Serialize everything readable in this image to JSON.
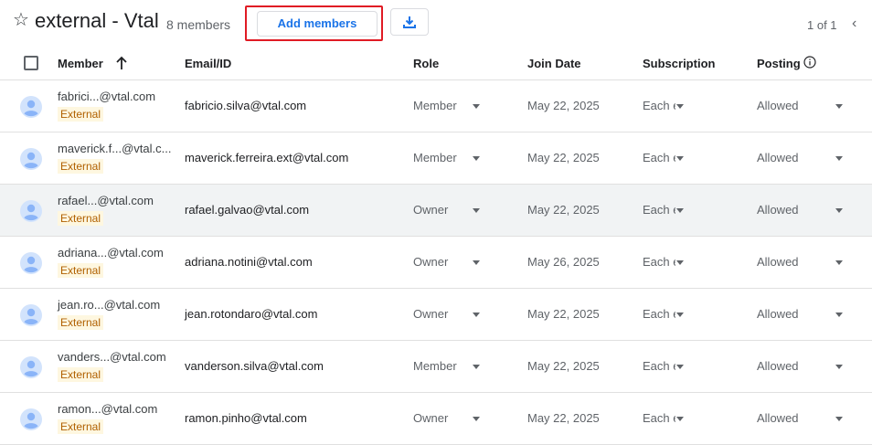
{
  "header": {
    "title": "external - Vtal",
    "member_count": "8 members",
    "add_members_label": "Add members",
    "pagination": "1 of 1"
  },
  "columns": {
    "member": "Member",
    "email": "Email/ID",
    "role": "Role",
    "join_date": "Join Date",
    "subscription": "Subscription",
    "posting": "Posting"
  },
  "rows": [
    {
      "member": "fabrici...@vtal.com",
      "badge": "External",
      "email": "fabricio.silva@vtal.com",
      "role": "Member",
      "join_date": "May 22, 2025",
      "subscription": "Each email",
      "posting": "Allowed"
    },
    {
      "member": "maverick.f...@vtal.c...",
      "badge": "External",
      "email": "maverick.ferreira.ext@vtal.com",
      "role": "Member",
      "join_date": "May 22, 2025",
      "subscription": "Each email",
      "posting": "Allowed"
    },
    {
      "member": "rafael...@vtal.com",
      "badge": "External",
      "email": "rafael.galvao@vtal.com",
      "role": "Owner",
      "join_date": "May 22, 2025",
      "subscription": "Each email",
      "posting": "Allowed"
    },
    {
      "member": "adriana...@vtal.com",
      "badge": "External",
      "email": "adriana.notini@vtal.com",
      "role": "Owner",
      "join_date": "May 26, 2025",
      "subscription": "Each email",
      "posting": "Allowed"
    },
    {
      "member": "jean.ro...@vtal.com",
      "badge": "External",
      "email": "jean.rotondaro@vtal.com",
      "role": "Owner",
      "join_date": "May 22, 2025",
      "subscription": "Each email",
      "posting": "Allowed"
    },
    {
      "member": "vanders...@vtal.com",
      "badge": "External",
      "email": "vanderson.silva@vtal.com",
      "role": "Member",
      "join_date": "May 22, 2025",
      "subscription": "Each email",
      "posting": "Allowed"
    },
    {
      "member": "ramon...@vtal.com",
      "badge": "External",
      "email": "ramon.pinho@vtal.com",
      "role": "Owner",
      "join_date": "May 22, 2025",
      "subscription": "Each email",
      "posting": "Allowed"
    }
  ],
  "icons": {
    "favorite": "star-outline-icon",
    "download": "download-icon",
    "sort": "arrow-up-icon",
    "info": "info-icon",
    "avatar": "person-avatar-icon",
    "dropdown": "caret-down-icon",
    "prev_page": "chevron-left-icon"
  },
  "colors": {
    "accent": "#1a73e8",
    "highlight_border": "#e01b24",
    "badge_text": "#b06000",
    "badge_bg": "#fef7e0",
    "avatar": "#8ab4f8",
    "avatar_bg": "#d2e3fc",
    "hover_row": "#f1f3f4"
  }
}
